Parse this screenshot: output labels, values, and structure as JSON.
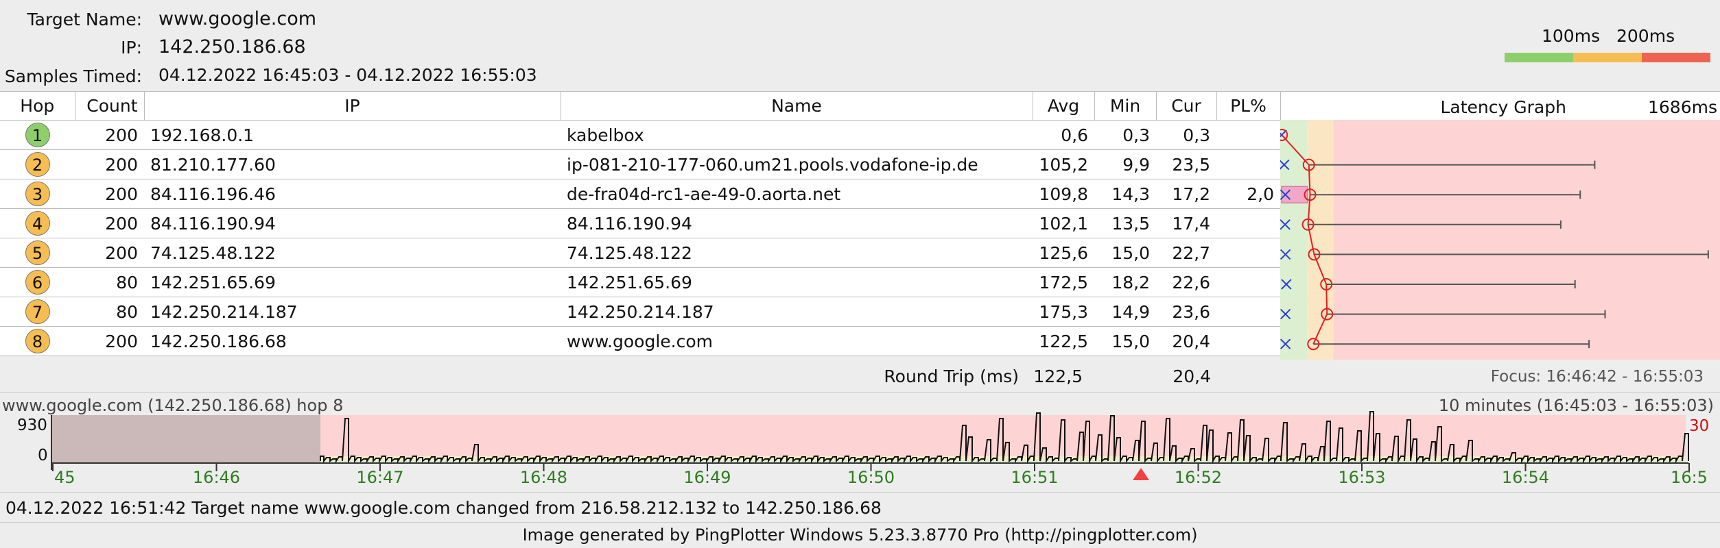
{
  "header": {
    "target_label": "Target Name:",
    "target_value": "www.google.com",
    "ip_label": "IP:",
    "ip_value": "142.250.186.68",
    "samples_label": "Samples Timed:",
    "samples_value": "04.12.2022 16:45:03 - 04.12.2022 16:55:03"
  },
  "scale": {
    "label_100": "100ms",
    "label_200": "200ms",
    "colors": {
      "good": "#8fcf6b",
      "mid": "#f6bd52",
      "bad": "#ef6450"
    }
  },
  "table": {
    "columns": [
      "Hop",
      "Count",
      "IP",
      "Name",
      "Avg",
      "Min",
      "Cur",
      "PL%",
      "Latency Graph"
    ],
    "max_latency_label": "1686ms",
    "rows": [
      {
        "hop": "1",
        "count": "200",
        "ip": "192.168.0.1",
        "name": "kabelbox",
        "avg": "0,6",
        "min": "0,3",
        "cur": "0,3",
        "pl": "",
        "color": "#8fcf6b"
      },
      {
        "hop": "2",
        "count": "200",
        "ip": "81.210.177.60",
        "name": "ip-081-210-177-060.um21.pools.vodafone-ip.de",
        "avg": "105,2",
        "min": "9,9",
        "cur": "23,5",
        "pl": "",
        "color": "#f6bd52"
      },
      {
        "hop": "3",
        "count": "200",
        "ip": "84.116.196.46",
        "name": "de-fra04d-rc1-ae-49-0.aorta.net",
        "avg": "109,8",
        "min": "14,3",
        "cur": "17,2",
        "pl": "2,0",
        "color": "#f6bd52"
      },
      {
        "hop": "4",
        "count": "200",
        "ip": "84.116.190.94",
        "name": "84.116.190.94",
        "avg": "102,1",
        "min": "13,5",
        "cur": "17,4",
        "pl": "",
        "color": "#f6bd52"
      },
      {
        "hop": "5",
        "count": "200",
        "ip": "74.125.48.122",
        "name": "74.125.48.122",
        "avg": "125,6",
        "min": "15,0",
        "cur": "22,7",
        "pl": "",
        "color": "#f6bd52"
      },
      {
        "hop": "6",
        "count": "80",
        "ip": "142.251.65.69",
        "name": "142.251.65.69",
        "avg": "172,5",
        "min": "18,2",
        "cur": "22,6",
        "pl": "",
        "color": "#f6bd52"
      },
      {
        "hop": "7",
        "count": "80",
        "ip": "142.250.214.187",
        "name": "142.250.214.187",
        "avg": "175,3",
        "min": "14,9",
        "cur": "23,6",
        "pl": "",
        "color": "#f6bd52"
      },
      {
        "hop": "8",
        "count": "200",
        "ip": "142.250.186.68",
        "name": "www.google.com",
        "avg": "122,5",
        "min": "15,0",
        "cur": "20,4",
        "pl": "",
        "color": "#f6bd52"
      }
    ],
    "round_trip_label": "Round Trip (ms)",
    "round_trip_avg": "122,5",
    "round_trip_cur": "20,4",
    "focus_text": "Focus: 16:46:42 - 16:55:03"
  },
  "timeline": {
    "title": "www.google.com (142.250.186.68) hop 8",
    "range_text": "10 minutes (16:45:03 - 16:55:03)",
    "y_max_label": "930",
    "y_min_label": "0",
    "right_label": "30",
    "x_labels": [
      "45",
      "16:46",
      "16:47",
      "16:48",
      "16:49",
      "16:50",
      "16:51",
      "16:52",
      "16:53",
      "16:54",
      "16:5"
    ]
  },
  "status": {
    "event_text": "04.12.2022 16:51:42 Target name www.google.com changed from 216.58.212.132 to 142.250.186.68",
    "footer_text": "Image generated by PingPlotter Windows 5.23.3.8770 Pro (http://pingplotter.com)"
  }
}
